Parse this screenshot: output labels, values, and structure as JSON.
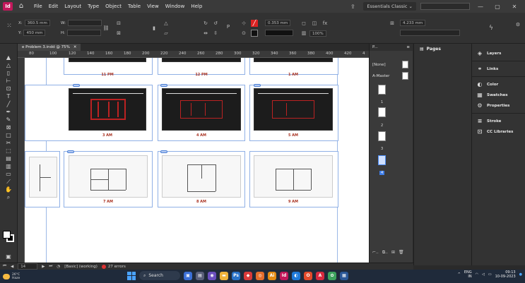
{
  "menubar": {
    "logo": "Id",
    "items": [
      "File",
      "Edit",
      "Layout",
      "Type",
      "Object",
      "Table",
      "View",
      "Window",
      "Help"
    ],
    "workspace": "Essentials Classic",
    "window_buttons": [
      "—",
      "▢",
      "✕"
    ]
  },
  "controlbar": {
    "x_label": "X:",
    "x_value": "360.5 mm",
    "y_label": "Y:",
    "y_value": "450 mm",
    "w_label": "W:",
    "h_label": "H:",
    "stroke_value": "0.353 mm",
    "opacity_value": "100%",
    "size_value": "4.233 mm"
  },
  "document": {
    "tab_title": "e Problem 3.indd @ 75%",
    "tab_close": "✕"
  },
  "ruler": {
    "ticks": [
      "80",
      "100",
      "120",
      "140",
      "160",
      "180",
      "200",
      "220",
      "240",
      "260",
      "280",
      "300",
      "320",
      "340",
      "360",
      "380",
      "400",
      "420",
      "4"
    ]
  },
  "spreads": {
    "row1_captions": [
      "11 PM",
      "12 PM",
      "1 AM"
    ],
    "row2_captions": [
      "3 AM",
      "4 AM",
      "5 AM"
    ],
    "row3_captions": [
      "7 AM",
      "8 AM",
      "9 AM"
    ]
  },
  "pages_mini": {
    "title": "P...",
    "none_label": "[None]",
    "master_label": "A-Master",
    "page_numbers": [
      "1",
      "2",
      "3",
      "4"
    ],
    "footer": [
      "⌐..",
      "⧉..",
      "⊞",
      "🗑"
    ]
  },
  "pages_panel": {
    "title": "Pages"
  },
  "dock": {
    "items": [
      {
        "icon": "◈",
        "label": "Layers"
      },
      {
        "icon": "⚭",
        "label": "Links"
      },
      {
        "icon": "◐",
        "label": "Color"
      },
      {
        "icon": "▦",
        "label": "Swatches"
      },
      {
        "icon": "⚙",
        "label": "Properties"
      },
      {
        "icon": "≡",
        "label": "Stroke"
      },
      {
        "icon": "⊡",
        "label": "CC Libraries"
      }
    ]
  },
  "statusbar": {
    "page_field": "14",
    "preflight_profile": "[Basic] (working)",
    "errors": "27 errors"
  },
  "taskbar": {
    "weather_temp": "26°C",
    "weather_desc": "Haze",
    "search_label": "Search",
    "lang_top": "ENG",
    "lang_bottom": "IN",
    "time": "09:13",
    "date": "10-09-2023"
  },
  "colors": {
    "accent": "#3f7ee8",
    "indesign_brand": "#c2185b",
    "guide": "#9bb8e6"
  }
}
